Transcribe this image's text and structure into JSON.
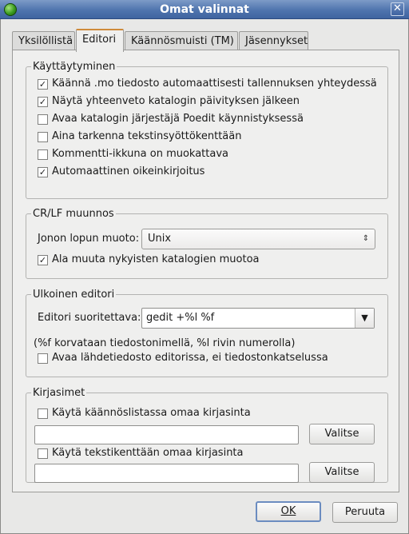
{
  "window": {
    "title": "Omat valinnat"
  },
  "tabs": [
    {
      "label": "Yksilöllistä"
    },
    {
      "label": "Editori"
    },
    {
      "label": "Käännösmuisti (TM)"
    },
    {
      "label": "Jäsennykset"
    }
  ],
  "behaviour": {
    "legend": "Käyttäytyminen",
    "options": [
      {
        "label": "Käännä .mo tiedosto automaattisesti tallennuksen yhteydessä",
        "checked": true
      },
      {
        "label": "Näytä yhteenveto katalogin päivityksen jälkeen",
        "checked": true
      },
      {
        "label": "Avaa katalogin järjestäjä Poedit käynnistyksessä",
        "checked": false
      },
      {
        "label": "Aina tarkenna tekstinsyöttökenttään",
        "checked": false
      },
      {
        "label": "Kommentti-ikkuna on muokattava",
        "checked": false
      },
      {
        "label": "Automaattinen oikeinkirjoitus",
        "checked": true
      }
    ]
  },
  "crlf": {
    "legend": "CR/LF muunnos",
    "line_ending_label": "Jonon lopun muoto:",
    "line_ending_value": "Unix",
    "keep_format_label": "Ala muuta nykyisten katalogien muotoa",
    "keep_format_checked": true
  },
  "external_editor": {
    "legend": "Ulkoinen editori",
    "command_label": "Editori suoritettava:",
    "command_value": "gedit +%l %f",
    "hint": "(%f korvataan tiedostonimellä, %l rivin numerolla)",
    "open_source_label": "Avaa lähdetiedosto editorissa, ei tiedostonkatselussa",
    "open_source_checked": false
  },
  "fonts": {
    "legend": "Kirjasimet",
    "list_font_label": "Käytä käännöslistassa omaa kirjasinta",
    "list_font_checked": false,
    "list_font_value": "",
    "text_font_label": "Käytä tekstikenttään omaa kirjasinta",
    "text_font_checked": false,
    "text_font_value": "",
    "choose_label": "Valitse"
  },
  "footer": {
    "ok_label": "OK",
    "cancel_label": "Peruuta"
  }
}
